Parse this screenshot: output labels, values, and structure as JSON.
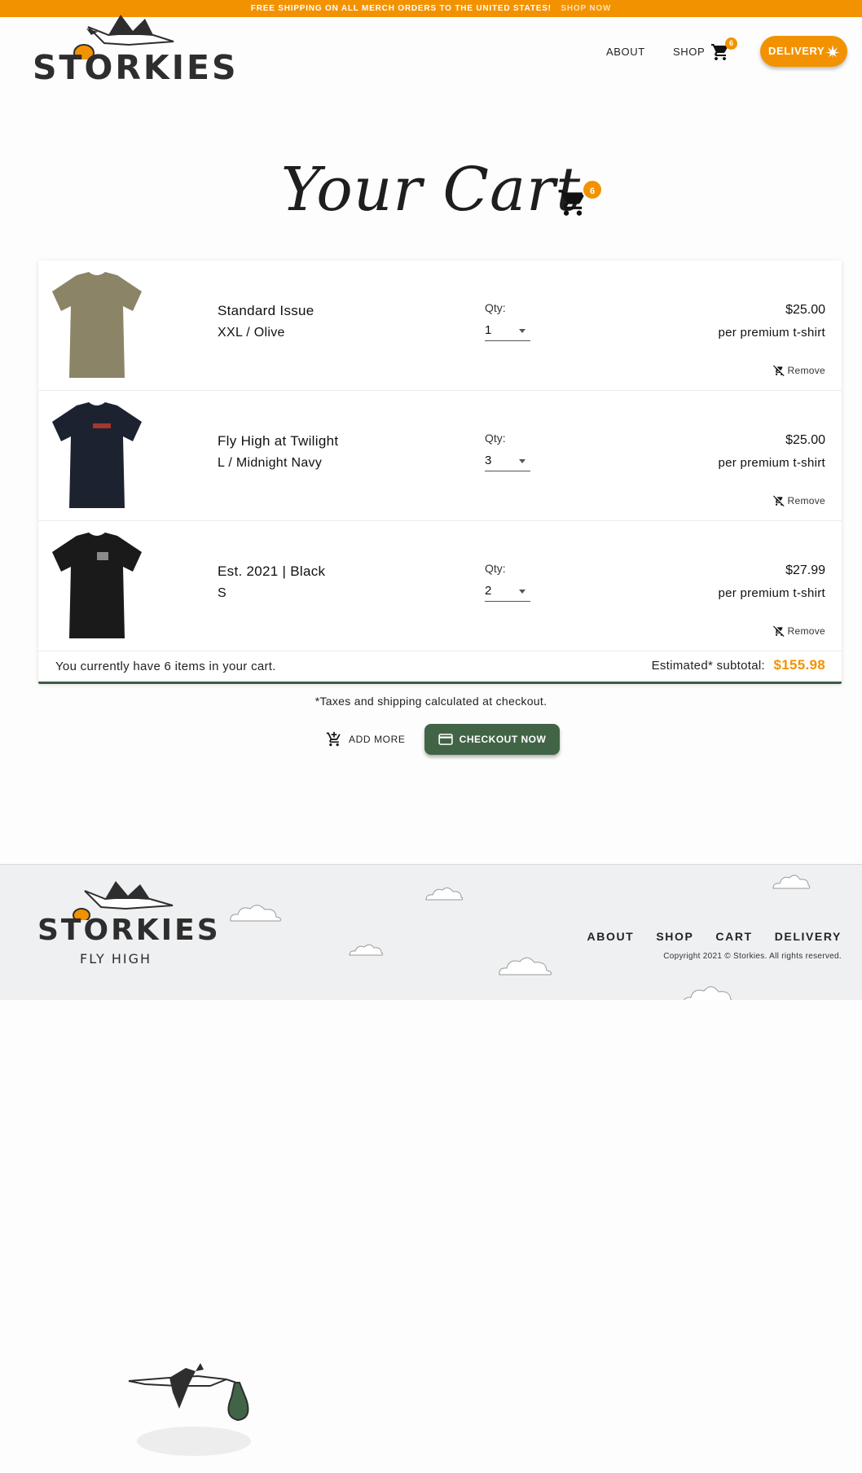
{
  "promo": {
    "text": "FREE SHIPPING ON ALL MERCH ORDERS TO THE UNITED STATES!",
    "link": "SHOP NOW"
  },
  "brand": {
    "name": "STORKIES",
    "tagline": "FLY HIGH",
    "primary_color": "#f39200",
    "accent_color": "#426446"
  },
  "nav": {
    "about": "ABOUT",
    "shop": "SHOP",
    "cart_count": "6",
    "delivery": "DELIVERY"
  },
  "page": {
    "title": "Your Cart",
    "cart_count": "6"
  },
  "cart": {
    "items": [
      {
        "name": "Standard Issue",
        "variant": "XXL / Olive",
        "qty_label": "Qty:",
        "qty": "1",
        "price": "$25.00",
        "per_unit": "per premium t-shirt",
        "remove": "Remove",
        "shirt_color": "#8b8466"
      },
      {
        "name": "Fly High at Twilight",
        "variant": "L / Midnight Navy",
        "qty_label": "Qty:",
        "qty": "3",
        "price": "$25.00",
        "per_unit": "per premium t-shirt",
        "remove": "Remove",
        "shirt_color": "#1d2230"
      },
      {
        "name": "Est. 2021 | Black",
        "variant": "S",
        "qty_label": "Qty:",
        "qty": "2",
        "price": "$27.99",
        "per_unit": "per premium t-shirt",
        "remove": "Remove",
        "shirt_color": "#1a1a1a"
      }
    ],
    "summary_text": "You currently have 6 items in your cart.",
    "subtotal_label": "Estimated* subtotal:",
    "subtotal": "$155.98"
  },
  "checkout": {
    "tax_note": "*Taxes and shipping calculated at checkout.",
    "add_more": "ADD MORE",
    "checkout_now": "CHECKOUT NOW"
  },
  "footer": {
    "links": [
      "ABOUT",
      "SHOP",
      "CART",
      "DELIVERY"
    ],
    "copyright": "Copyright 2021 © Storkies. All rights reserved."
  }
}
